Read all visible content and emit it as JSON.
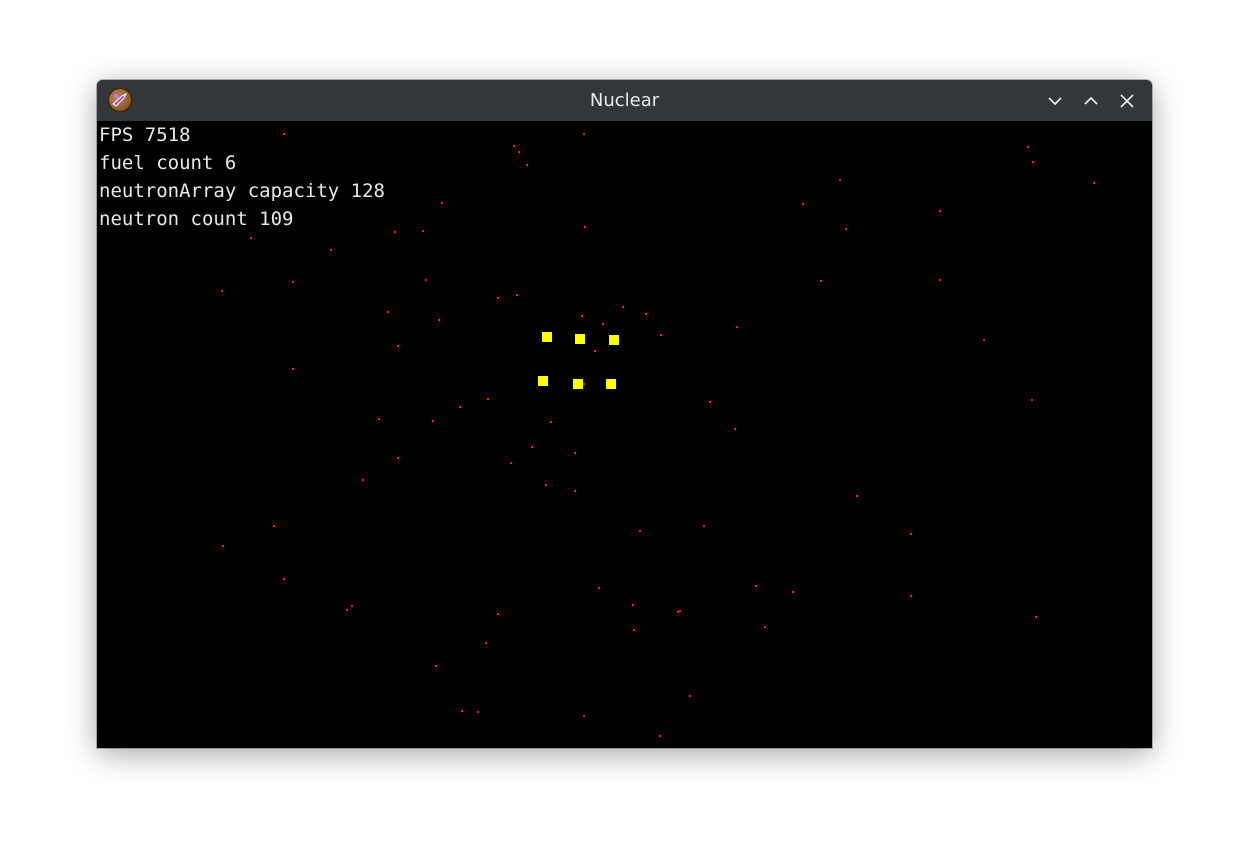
{
  "window": {
    "title": "Nuclear",
    "icon": "app-icon"
  },
  "hud": {
    "fps": "FPS 7518",
    "fuel": "fuel count 6",
    "capacity": "neutronArray capacity 128",
    "neutrons": "neutron count 109"
  },
  "colors": {
    "background": "#000000",
    "fuel": "#ffff00",
    "neutron": "#ff1a1a",
    "hud_text": "#e8e8e8",
    "titlebar": "#33363a"
  }
}
